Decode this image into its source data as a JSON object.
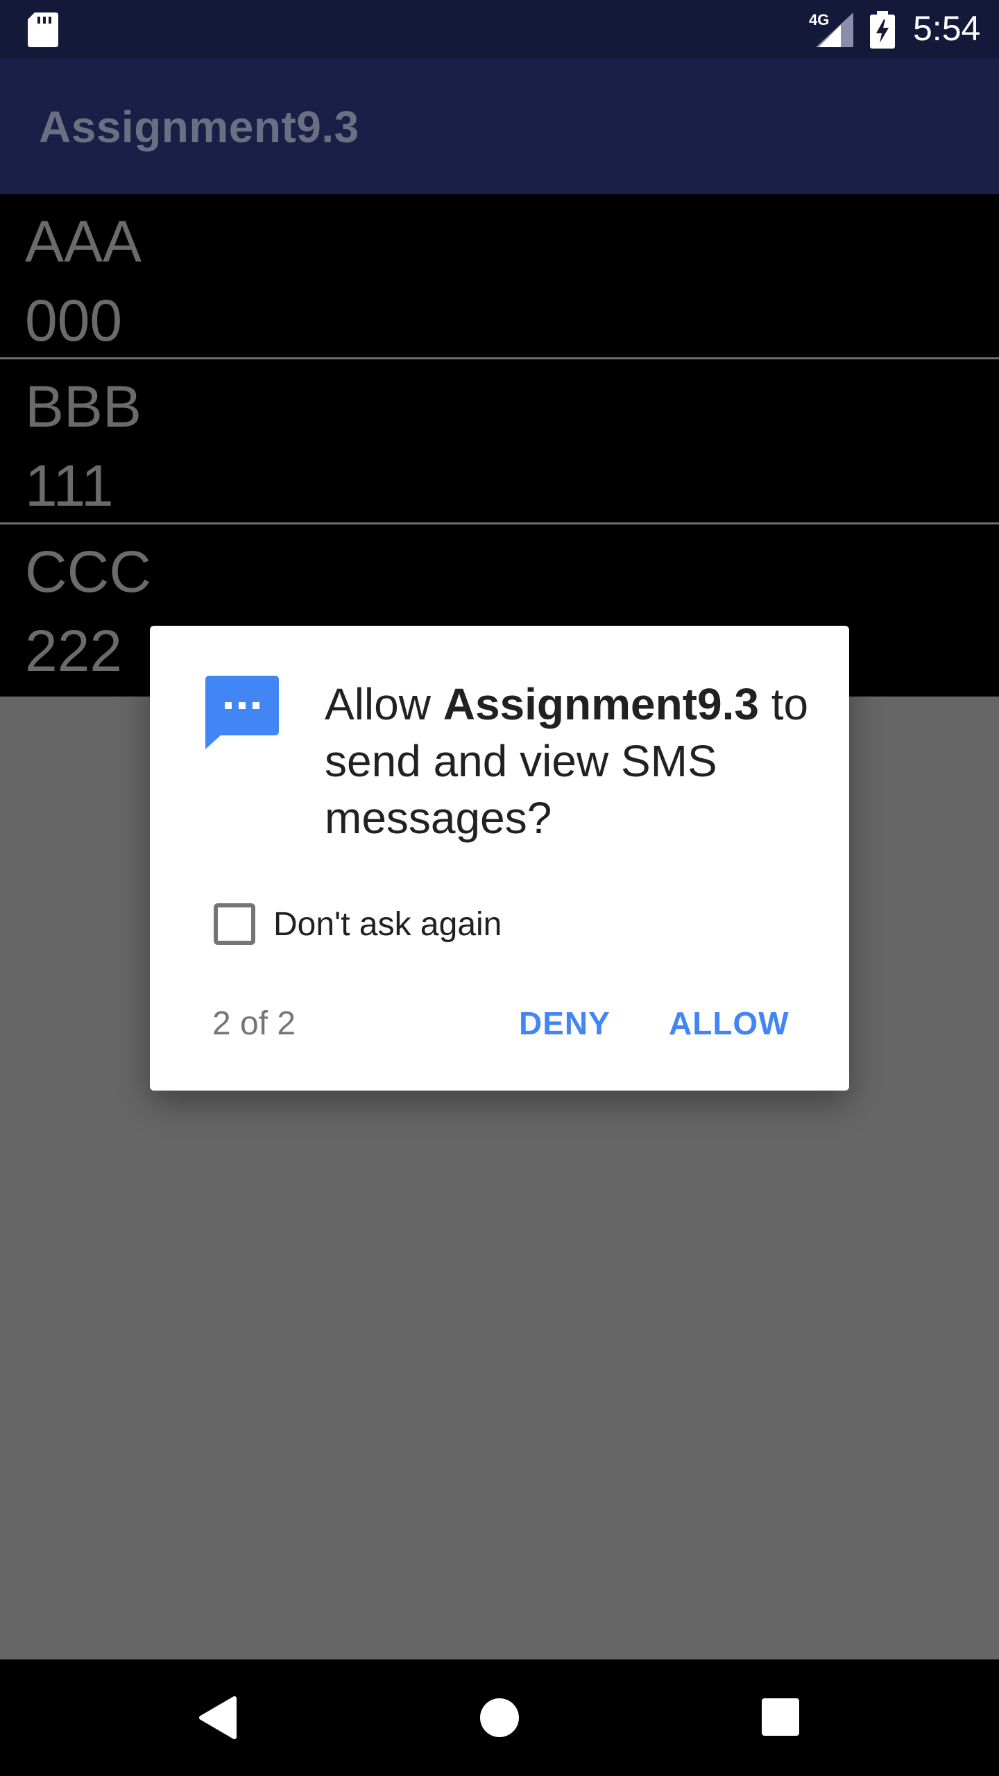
{
  "status_bar": {
    "time": "5:54",
    "network_type": "4G",
    "icons": [
      "sd-card-icon",
      "signal-icon",
      "battery-charging-icon"
    ]
  },
  "app_bar": {
    "title": "Assignment9.3"
  },
  "list": {
    "items": [
      {
        "line1": "AAA",
        "line2": "000"
      },
      {
        "line1": "BBB",
        "line2": "111"
      },
      {
        "line1": "CCC",
        "line2": "222"
      }
    ]
  },
  "dialog": {
    "icon": "sms-icon",
    "message_prefix": "Allow ",
    "app_name": "Assignment9.3",
    "message_suffix": " to send and view SMS messages?",
    "checkbox_label": "Don't ask again",
    "checkbox_checked": false,
    "counter": "2 of 2",
    "deny_label": "DENY",
    "allow_label": "ALLOW",
    "accent_color": "#4285f4"
  },
  "nav_bar": {
    "icons": [
      "back-icon",
      "home-icon",
      "recent-apps-icon"
    ]
  }
}
